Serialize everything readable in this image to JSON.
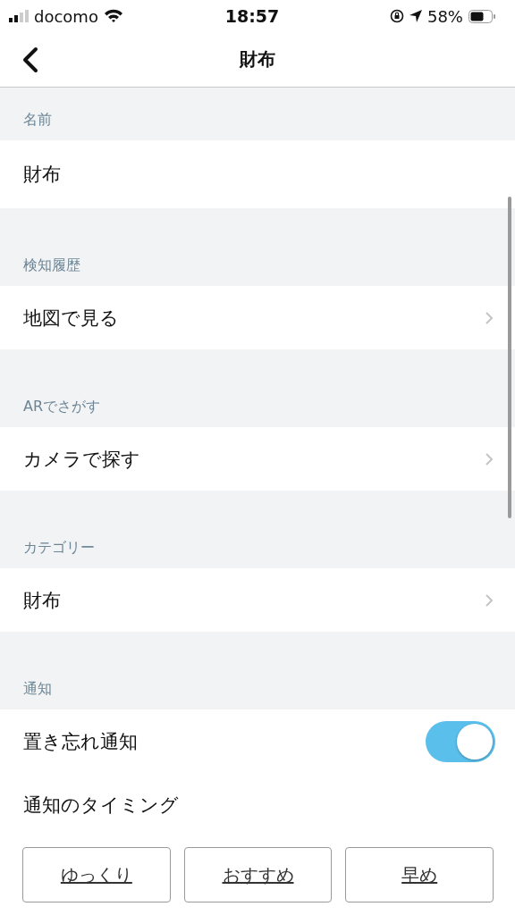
{
  "status_bar": {
    "carrier": "docomo",
    "time": "18:57",
    "battery": "58%"
  },
  "nav": {
    "title": "財布"
  },
  "sections": [
    {
      "header": "名前",
      "rows": [
        {
          "kind": "text",
          "label": "財布"
        }
      ]
    },
    {
      "header": "検知履歴",
      "rows": [
        {
          "kind": "link",
          "label": "地図で見る"
        }
      ]
    },
    {
      "header": "ARでさがす",
      "rows": [
        {
          "kind": "link",
          "label": "カメラで探す"
        }
      ]
    },
    {
      "header": "カテゴリー",
      "rows": [
        {
          "kind": "link",
          "label": "財布"
        }
      ]
    },
    {
      "header": "通知",
      "rows": [
        {
          "kind": "toggle",
          "label": "置き忘れ通知",
          "on": true
        },
        {
          "kind": "text",
          "label": "通知のタイミング"
        },
        {
          "kind": "buttons",
          "options": [
            "ゆっくり",
            "おすすめ",
            "早め"
          ]
        }
      ]
    }
  ]
}
